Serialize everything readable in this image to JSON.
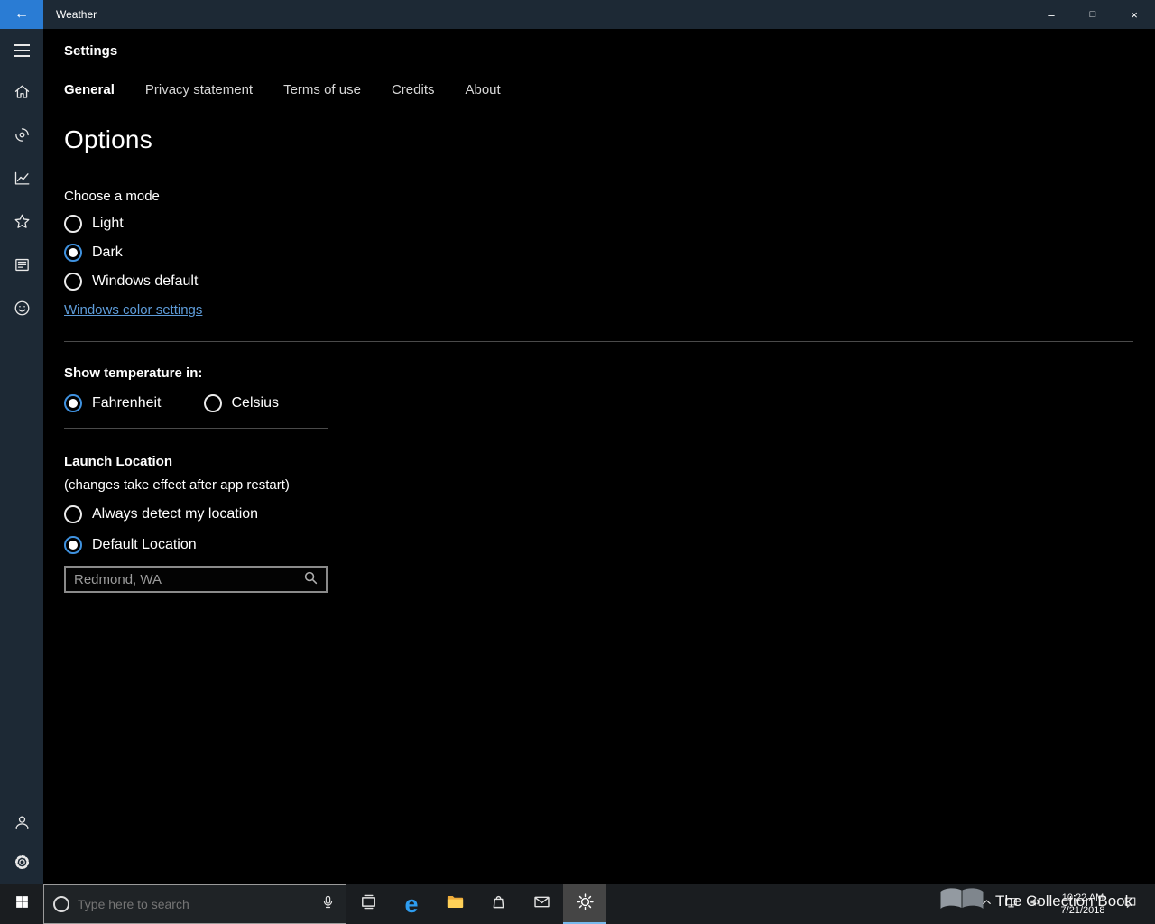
{
  "window": {
    "title": "Weather",
    "back_glyph": "←",
    "minimize_glyph": "–",
    "maximize_glyph": "□",
    "close_glyph": "×"
  },
  "sidebar": {
    "items": [
      {
        "id": "menu",
        "icon": "hamburger-icon"
      },
      {
        "id": "forecast-home",
        "icon": "home-icon"
      },
      {
        "id": "maps",
        "icon": "hurricane-icon"
      },
      {
        "id": "historical-weather",
        "icon": "line-chart-icon"
      },
      {
        "id": "favorites",
        "icon": "star-icon"
      },
      {
        "id": "news",
        "icon": "news-icon"
      },
      {
        "id": "send-feedback",
        "icon": "smiley-icon"
      }
    ],
    "bottom_items": [
      {
        "id": "sign-in",
        "icon": "person-icon"
      },
      {
        "id": "settings",
        "icon": "gear-icon"
      }
    ]
  },
  "settings": {
    "heading": "Settings",
    "tabs": [
      {
        "label": "General",
        "active": true
      },
      {
        "label": "Privacy statement",
        "active": false
      },
      {
        "label": "Terms of use",
        "active": false
      },
      {
        "label": "Credits",
        "active": false
      },
      {
        "label": "About",
        "active": false
      }
    ],
    "options_heading": "Options",
    "mode_group": {
      "label": "Choose a mode",
      "options": [
        {
          "label": "Light",
          "selected": false
        },
        {
          "label": "Dark",
          "selected": true
        },
        {
          "label": "Windows default",
          "selected": false
        }
      ],
      "link_label": "Windows color settings"
    },
    "temperature_group": {
      "label": "Show temperature in:",
      "options": [
        {
          "label": "Fahrenheit",
          "selected": true
        },
        {
          "label": "Celsius",
          "selected": false
        }
      ]
    },
    "location_group": {
      "label": "Launch Location",
      "note": "(changes take effect after app restart)",
      "options": [
        {
          "label": "Always detect my location",
          "selected": false
        },
        {
          "label": "Default Location",
          "selected": true
        }
      ],
      "search_value": "Redmond, WA"
    }
  },
  "taskbar": {
    "search_placeholder": "Type here to search",
    "apps": [
      {
        "id": "task-view",
        "icon": "task-view-icon",
        "active": false
      },
      {
        "id": "edge",
        "icon": "edge-icon",
        "glyph": "e",
        "active": false
      },
      {
        "id": "file-explorer",
        "icon": "folder-icon",
        "active": false
      },
      {
        "id": "store",
        "icon": "store-bag-icon",
        "active": false
      },
      {
        "id": "mail",
        "icon": "mail-icon",
        "active": false
      },
      {
        "id": "weather",
        "icon": "sun-icon",
        "active": true
      }
    ],
    "tray": {
      "time": "10:22 AM",
      "date": "7/21/2018"
    },
    "watermark": "The Collection Book"
  },
  "colors": {
    "accent": "#3f92e0",
    "titlebar_bg": "#1d2935",
    "sidebar_bg": "#1d2935",
    "back_button_bg": "#2a7cd4",
    "content_bg": "#000000",
    "link": "#5e9cd9",
    "taskbar_bg": "#1a1d20",
    "active_app_bg": "#454545"
  }
}
